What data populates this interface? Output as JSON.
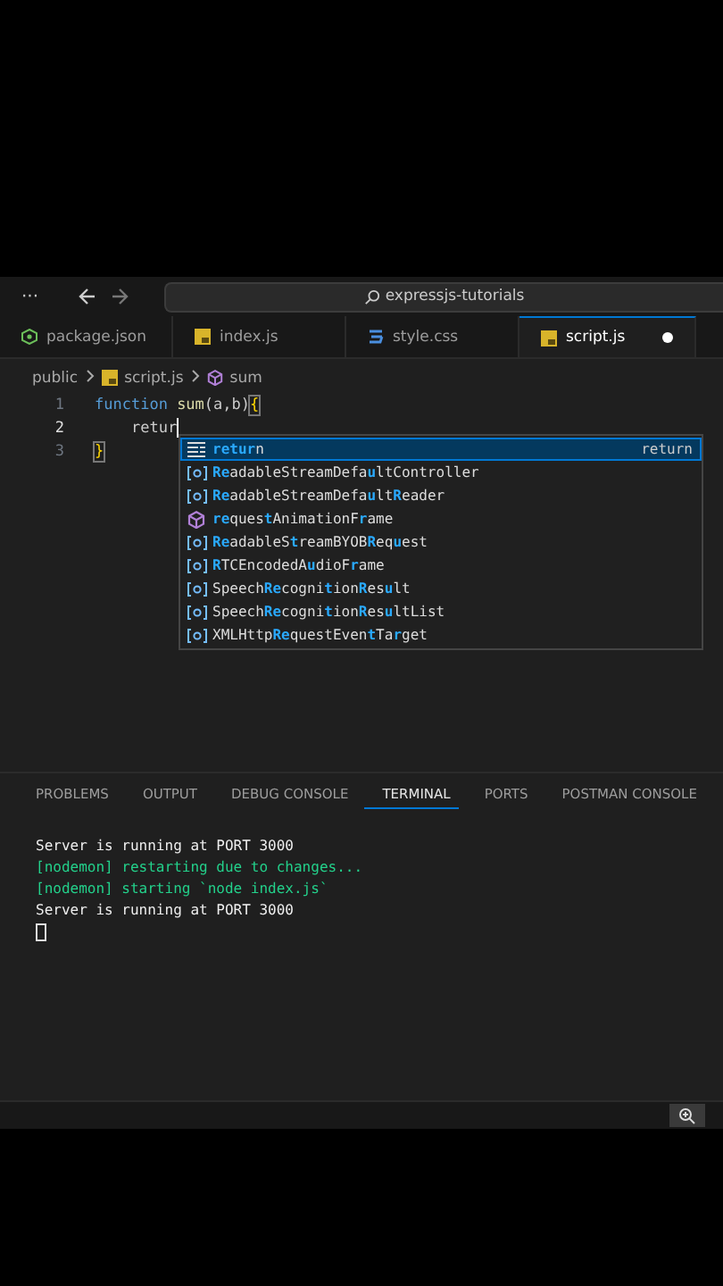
{
  "title_bar": {
    "menu": "···",
    "search": "expressjs-tutorials"
  },
  "tabs": [
    {
      "label": "package.json",
      "kind": "json",
      "selected": false,
      "modified": false
    },
    {
      "label": "index.js",
      "kind": "js",
      "selected": false,
      "modified": false
    },
    {
      "label": "style.css",
      "kind": "css",
      "selected": false,
      "modified": false
    },
    {
      "label": "script.js",
      "kind": "js",
      "selected": true,
      "modified": true
    }
  ],
  "breadcrumb": [
    {
      "label": "public",
      "kind": "folder"
    },
    {
      "label": "script.js",
      "kind": "js"
    },
    {
      "label": "sum",
      "kind": "symbol"
    }
  ],
  "editor": {
    "lines": [
      {
        "number": "1",
        "active": false,
        "tokens": [
          {
            "text": "function ",
            "kind": "keyword"
          },
          {
            "text": "sum",
            "kind": "function"
          },
          {
            "text": "(a,b)",
            "kind": "plain"
          },
          {
            "text": "{",
            "kind": "bracket"
          }
        ]
      },
      {
        "number": "2",
        "active": true,
        "tokens": [
          {
            "text": "    retur",
            "kind": "plain"
          }
        ]
      },
      {
        "number": "3",
        "active": false,
        "tokens": [
          {
            "text": "}",
            "kind": "bracket"
          }
        ]
      }
    ]
  },
  "suggestions": [
    {
      "label": "**retur**n",
      "kind": "keyword",
      "selected": true,
      "detail": "return"
    },
    {
      "label": "**Re**adableStreamDefa**u**ltController",
      "kind": "variable",
      "selected": false
    },
    {
      "label": "**Re**adableStreamDefa**u**lt**R**eader",
      "kind": "variable",
      "selected": false
    },
    {
      "label": "**re**ques**t**AnimationF**r**ame",
      "kind": "method",
      "selected": false
    },
    {
      "label": "**Re**adableS**t**reamBYOB**R**eq**u**est",
      "kind": "variable",
      "selected": false
    },
    {
      "label": "**R**TCEncodedA**u**dioF**r**ame",
      "kind": "variable",
      "selected": false
    },
    {
      "label": "Speech**Re**cogni**t**ion**R**es**u**lt",
      "kind": "variable",
      "selected": false
    },
    {
      "label": "Speech**Re**cogni**t**ion**R**es**u**ltList",
      "kind": "variable",
      "selected": false
    },
    {
      "label": "XMLHttp**Re**questEven**t**Ta**r**get",
      "kind": "variable",
      "selected": false
    }
  ],
  "panel_tabs": [
    {
      "label": "PROBLEMS",
      "selected": false
    },
    {
      "label": "OUTPUT",
      "selected": false
    },
    {
      "label": "DEBUG CONSOLE",
      "selected": false
    },
    {
      "label": "TERMINAL",
      "selected": true
    },
    {
      "label": "PORTS",
      "selected": false
    },
    {
      "label": "POSTMAN CONSOLE",
      "selected": false
    }
  ],
  "terminal": [
    {
      "text": "Server is running at PORT 3000",
      "kind": "output"
    },
    {
      "text": "[nodemon] restarting due to changes...",
      "kind": "nodemon"
    },
    {
      "text": "[nodemon] starting `node index.js`",
      "kind": "nodemon"
    },
    {
      "text": "Server is running at PORT 3000",
      "kind": "output"
    }
  ]
}
